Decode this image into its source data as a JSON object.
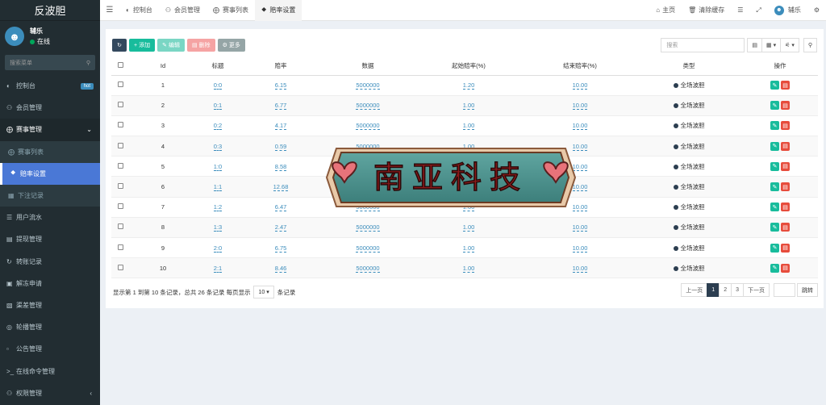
{
  "app": {
    "title": "反波胆"
  },
  "user": {
    "name": "辅乐",
    "status": "在线"
  },
  "sidebar": {
    "search_placeholder": "搜索菜单",
    "items": [
      {
        "label": "控制台",
        "icon": "dashboard-icon",
        "badge": "hot"
      },
      {
        "label": "会员管理",
        "icon": "users-icon"
      },
      {
        "label": "赛事管理",
        "icon": "circle-icon"
      },
      {
        "label": "赛事列表",
        "icon": "circle-icon"
      },
      {
        "label": "赔率设置",
        "icon": "vk-icon"
      },
      {
        "label": "下注记录",
        "icon": "table-icon"
      },
      {
        "label": "用户流水",
        "icon": "list-icon"
      },
      {
        "label": "提现管理",
        "icon": "file-icon"
      },
      {
        "label": "转账记录",
        "icon": "refresh-icon"
      },
      {
        "label": "解冻申请",
        "icon": "image-icon"
      },
      {
        "label": "渠差管理",
        "icon": "sliders-icon"
      },
      {
        "label": "轮播管理",
        "icon": "camera-icon"
      },
      {
        "label": "公告管理",
        "icon": "notice-icon"
      },
      {
        "label": "在线命令管理",
        "icon": "terminal-icon"
      },
      {
        "label": "权限管理",
        "icon": "group-icon"
      }
    ]
  },
  "topbar": {
    "tabs": [
      {
        "label": "控制台"
      },
      {
        "label": "会员管理"
      },
      {
        "label": "赛事列表"
      },
      {
        "label": "赔率设置"
      }
    ],
    "right": {
      "home": "主页",
      "clear_cache": "清除缓存",
      "user": "辅乐"
    }
  },
  "toolbar": {
    "add": "添加",
    "edit": "编辑",
    "delete": "删除",
    "more": "更多",
    "search_placeholder": "搜索"
  },
  "table": {
    "headers": [
      "Id",
      "标题",
      "赔率",
      "数据",
      "起始赔率(%)",
      "结束赔率(%)",
      "类型",
      "操作"
    ],
    "rows": [
      {
        "id": "1",
        "title": "0:0",
        "odds": "6.15",
        "data": "5000000",
        "start": "1.20",
        "end": "10.00",
        "type": "全场波胆"
      },
      {
        "id": "2",
        "title": "0:1",
        "odds": "6.77",
        "data": "5000000",
        "start": "1.00",
        "end": "10.00",
        "type": "全场波胆"
      },
      {
        "id": "3",
        "title": "0:2",
        "odds": "4.17",
        "data": "5000000",
        "start": "1.00",
        "end": "10.00",
        "type": "全场波胆"
      },
      {
        "id": "4",
        "title": "0:3",
        "odds": "0.59",
        "data": "5000000",
        "start": "1.00",
        "end": "10.00",
        "type": "全场波胆"
      },
      {
        "id": "5",
        "title": "1:0",
        "odds": "8.58",
        "data": "5000000",
        "start": "1.00",
        "end": "10.00",
        "type": "全场波胆"
      },
      {
        "id": "6",
        "title": "1:1",
        "odds": "12.68",
        "data": "5000000",
        "start": "1.00",
        "end": "10.00",
        "type": "全场波胆"
      },
      {
        "id": "7",
        "title": "1:2",
        "odds": "6.47",
        "data": "5000000",
        "start": "1.00",
        "end": "10.00",
        "type": "全场波胆"
      },
      {
        "id": "8",
        "title": "1:3",
        "odds": "2.47",
        "data": "5000000",
        "start": "1.00",
        "end": "10.00",
        "type": "全场波胆"
      },
      {
        "id": "9",
        "title": "2:0",
        "odds": "6.75",
        "data": "5000000",
        "start": "1.00",
        "end": "10.00",
        "type": "全场波胆"
      },
      {
        "id": "10",
        "title": "2:1",
        "odds": "8.46",
        "data": "5000000",
        "start": "1.00",
        "end": "10.00",
        "type": "全场波胆"
      }
    ]
  },
  "footer": {
    "info_prefix": "显示第 1 到第 10 条记录，总共 26 条记录 每页显示",
    "per_page": "10",
    "info_suffix": "条记录"
  },
  "pager": {
    "prev": "上一页",
    "pages": [
      "1",
      "2",
      "3"
    ],
    "next": "下一页",
    "jump": "跳转"
  },
  "watermark": {
    "text": "南亚科技"
  },
  "colors": {
    "sidebar_bg": "#222d32",
    "active": "#4a78d6",
    "green": "#18bc9c",
    "red": "#e74c3c",
    "link": "#3c8dbc"
  }
}
